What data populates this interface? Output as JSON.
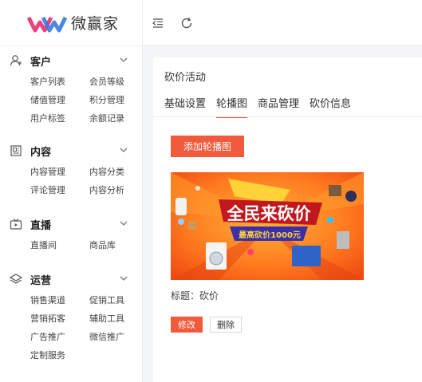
{
  "brand": {
    "name": "微赢家",
    "accent": "#f15a3b"
  },
  "sidebar": {
    "sections": [
      {
        "title": "客户",
        "icon": "user-icon",
        "items": [
          "客户列表",
          "会员等级",
          "储值管理",
          "积分管理",
          "用户标签",
          "余额记录"
        ]
      },
      {
        "title": "内容",
        "icon": "document-icon",
        "items": [
          "内容管理",
          "内容分类",
          "评论管理",
          "内容分析"
        ]
      },
      {
        "title": "直播",
        "icon": "tv-icon",
        "items": [
          "直播间",
          "商品库"
        ]
      },
      {
        "title": "运营",
        "icon": "layers-icon",
        "items": [
          "销售渠道",
          "促销工具",
          "营销拓客",
          "辅助工具",
          "广告推广",
          "微信推广",
          "定制服务"
        ]
      }
    ]
  },
  "topbar": {
    "icons": [
      "collapse-menu-icon",
      "refresh-icon"
    ]
  },
  "main": {
    "page_title": "砍价活动",
    "tabs": [
      "基础设置",
      "轮播图",
      "商品管理",
      "砍价信息"
    ],
    "active_tab": 1,
    "add_button": "添加轮播图",
    "banner": {
      "headline": "全民来砍价",
      "subline": "最高砍价1000元"
    },
    "caption": "标题：砍价",
    "edit_button": "修改",
    "delete_button": "删除"
  }
}
